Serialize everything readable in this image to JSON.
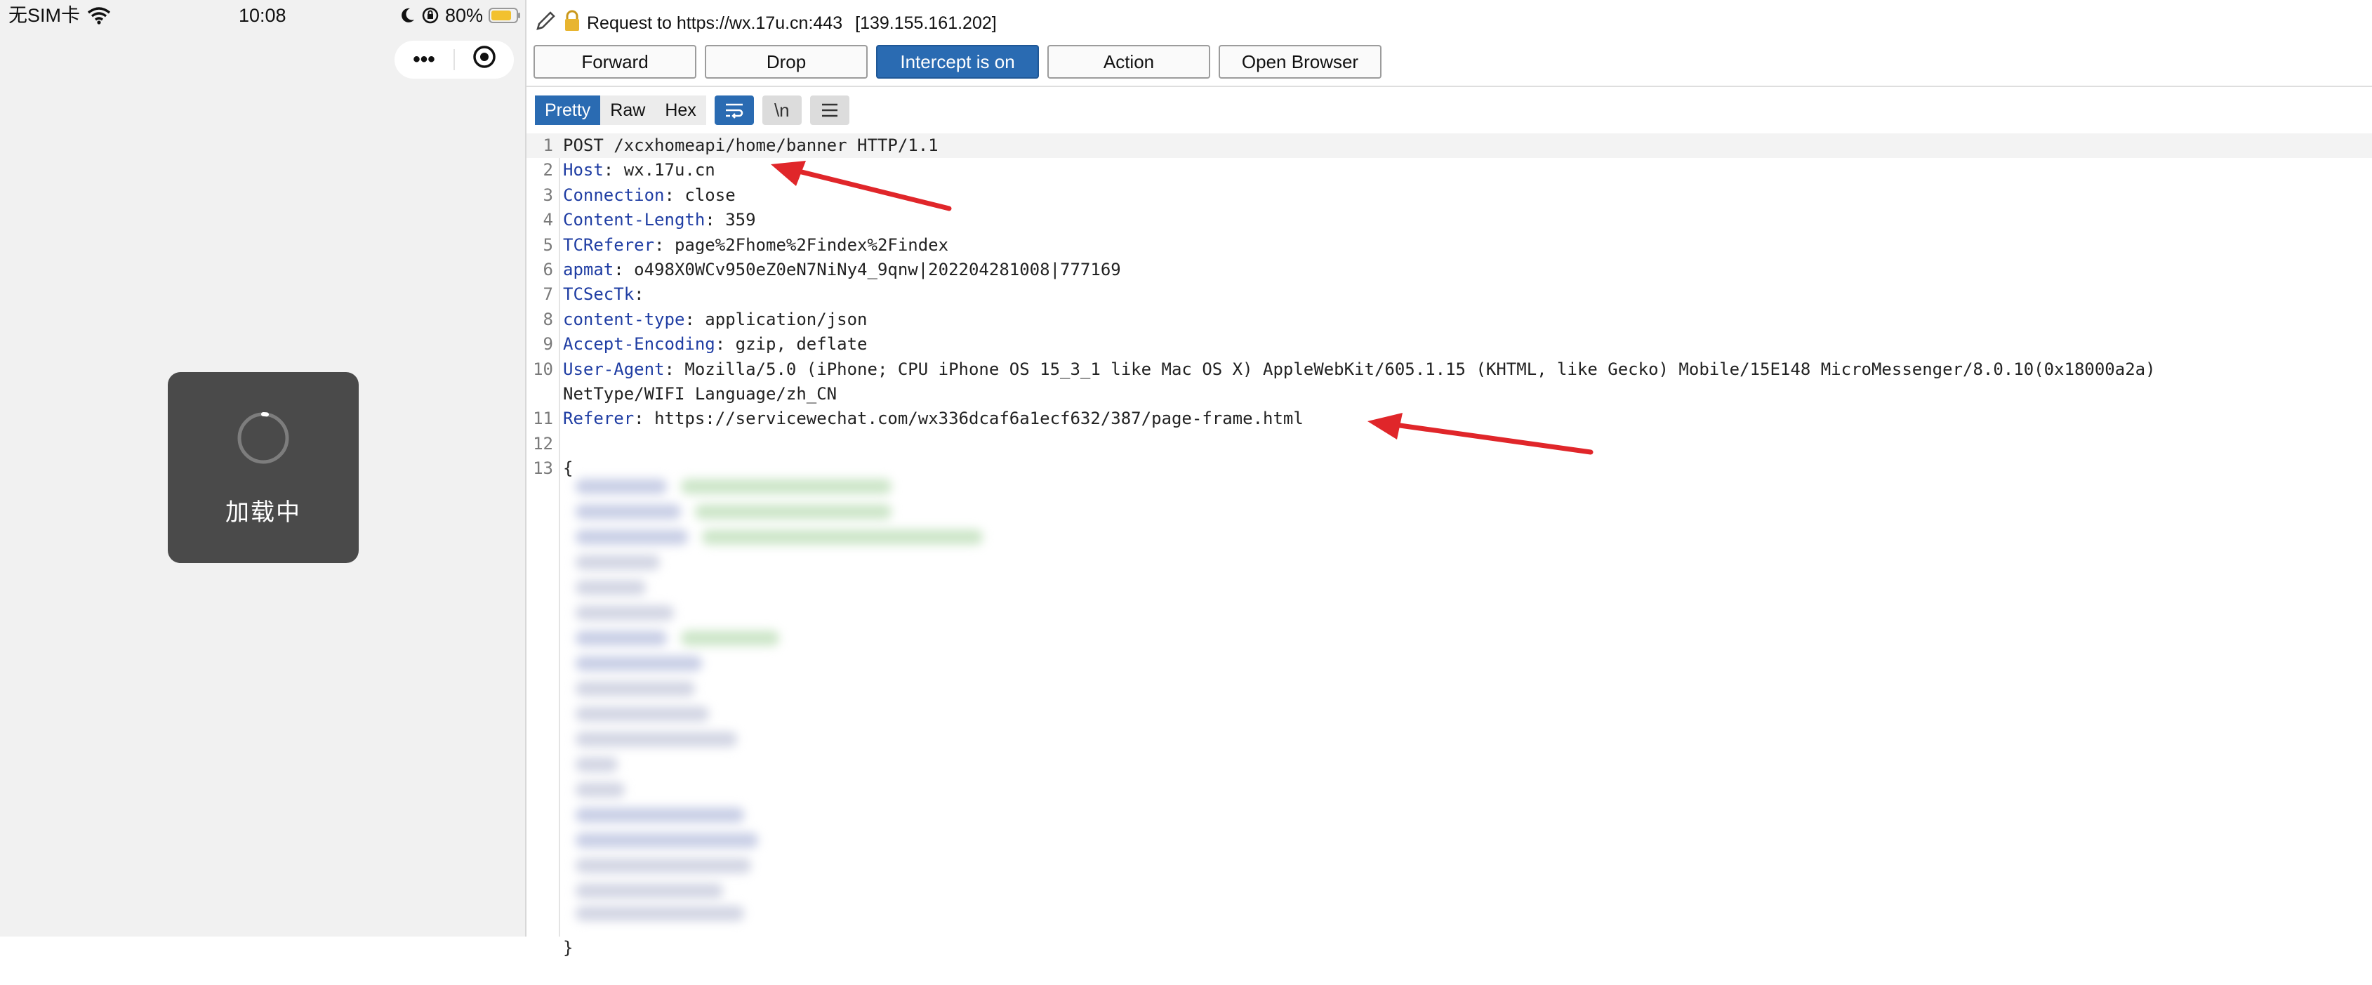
{
  "phone": {
    "carrier": "无SIM卡",
    "time": "10:08",
    "battery": "80%",
    "capsule_more": "•••",
    "toast_text": "加载中",
    "colors": {
      "toast_bg": "#4a4a4a",
      "battery_fill": "#f2c12e"
    }
  },
  "burp": {
    "request_prefix": "Request to https://wx.17u.cn:443",
    "request_ip": "[139.155.161.202]",
    "buttons": {
      "forward": "Forward",
      "drop": "Drop",
      "intercept": "Intercept is on",
      "action": "Action",
      "open_browser": "Open Browser"
    },
    "view_tabs": {
      "pretty": "Pretty",
      "raw": "Raw",
      "hex": "Hex",
      "newline": "\\n"
    },
    "accent": "#2a6bb2",
    "lines": [
      {
        "n": "1",
        "name": "",
        "sep": "",
        "value": "POST /xcxhomeapi/home/banner HTTP/1.1"
      },
      {
        "n": "2",
        "name": "Host",
        "sep": ": ",
        "value": "wx.17u.cn"
      },
      {
        "n": "3",
        "name": "Connection",
        "sep": ": ",
        "value": "close"
      },
      {
        "n": "4",
        "name": "Content-Length",
        "sep": ": ",
        "value": "359"
      },
      {
        "n": "5",
        "name": "TCReferer",
        "sep": ": ",
        "value": "page%2Fhome%2Findex%2Findex"
      },
      {
        "n": "6",
        "name": "apmat",
        "sep": ": ",
        "value": "o498X0WCv950eZ0eN7NiNy4_9qnw|202204281008|777169"
      },
      {
        "n": "7",
        "name": "TCSecTk",
        "sep": ":",
        "value": ""
      },
      {
        "n": "8",
        "name": "content-type",
        "sep": ": ",
        "value": "application/json"
      },
      {
        "n": "9",
        "name": "Accept-Encoding",
        "sep": ": ",
        "value": "gzip, deflate"
      },
      {
        "n": "10",
        "name": "User-Agent",
        "sep": ": ",
        "value": "Mozilla/5.0 (iPhone; CPU iPhone OS 15_3_1 like Mac OS X) AppleWebKit/605.1.15 (KHTML, like Gecko) Mobile/15E148 MicroMessenger/8.0.10(0x18000a2a)"
      },
      {
        "n": "",
        "name": "",
        "sep": "",
        "value": "NetType/WIFI Language/zh_CN"
      },
      {
        "n": "11",
        "name": "Referer",
        "sep": ": ",
        "value": "https://servicewechat.com/wx336dcaf6a1ecf632/387/page-frame.html"
      },
      {
        "n": "12",
        "name": "",
        "sep": "",
        "value": ""
      },
      {
        "n": "13",
        "name": "",
        "sep": "",
        "value": "{"
      }
    ],
    "closing_brace": "}"
  }
}
